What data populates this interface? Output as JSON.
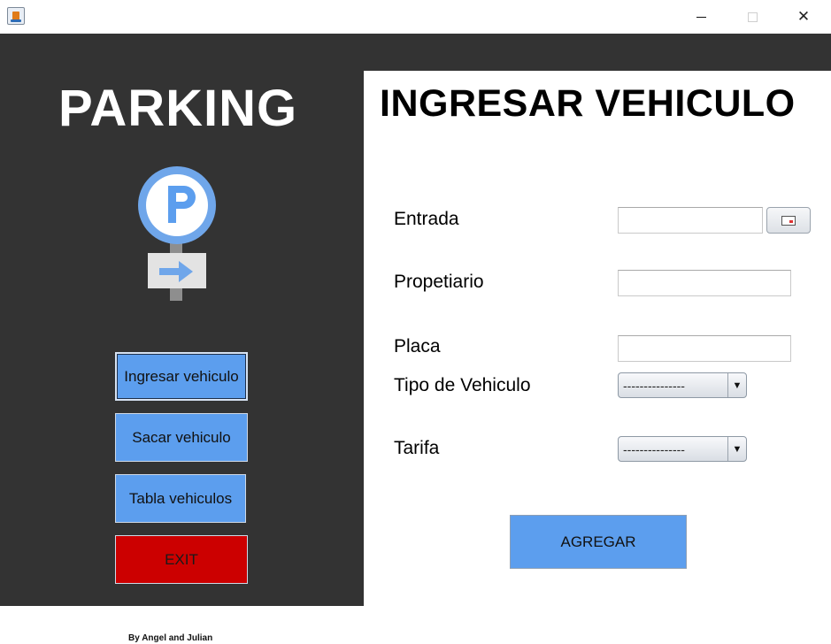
{
  "window": {
    "app_icon": "java-icon",
    "controls": [
      "minimize-icon",
      "maximize-icon",
      "close-icon"
    ],
    "close_glyph": "✕"
  },
  "sidebar": {
    "brand": "PARKING",
    "logo": "parking-sign-icon",
    "buttons": [
      {
        "label": "Ingresar vehiculo"
      },
      {
        "label": "Sacar vehiculo"
      },
      {
        "label": "Tabla vehiculos"
      },
      {
        "label": "EXIT"
      }
    ]
  },
  "main": {
    "title": "INGRESAR VEHICULO",
    "fields": {
      "entrada": {
        "label": "Entrada",
        "value": ""
      },
      "propietario": {
        "label": "Propetiario",
        "value": ""
      },
      "placa": {
        "label": "Placa",
        "value": ""
      },
      "tipo": {
        "label": "Tipo de Vehiculo",
        "selected": "---------------"
      },
      "tarifa": {
        "label": "Tarifa",
        "selected": "---------------"
      }
    },
    "calendar_icon": "calendar-icon",
    "add_button": "AGREGAR"
  },
  "footer": {
    "credits": "By Angel and Julian"
  },
  "colors": {
    "sidebar_bg": "#333333",
    "button_blue": "#5c9eee",
    "exit_red": "#cc0000",
    "sign_blue": "#5c9eee"
  }
}
